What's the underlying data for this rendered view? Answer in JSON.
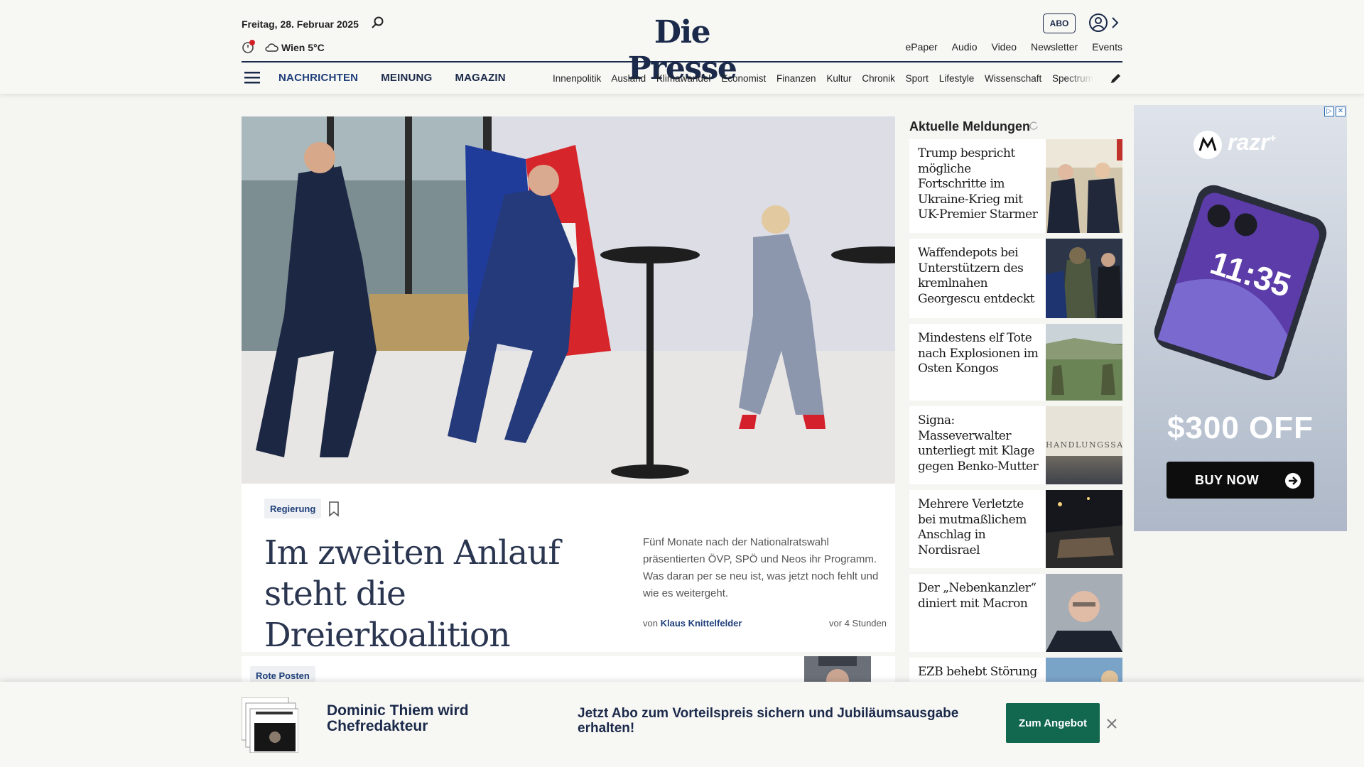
{
  "header": {
    "date": "Freitag, 28. Februar 2025",
    "weather": "Wien 5°C",
    "logo": "Die Presse",
    "abo_label": "ABO",
    "top_links": [
      "ePaper",
      "Audio",
      "Video",
      "Newsletter",
      "Events"
    ],
    "main_nav": [
      "NACHRICHTEN",
      "MEINUNG",
      "MAGAZIN"
    ],
    "sub_nav": [
      "Innenpolitik",
      "Ausland",
      "Klimawandel",
      "Economist",
      "Finanzen",
      "Kultur",
      "Chronik",
      "Sport",
      "Lifestyle",
      "Wissenschaft",
      "Spectrum"
    ]
  },
  "hero": {
    "tag": "Regierung",
    "headline": "Im zweiten Anlauf steht die Dreierkoalition",
    "teaser": "Fünf Monate nach der Nationalratswahl präsentierten ÖVP, SPÖ und Neos ihr Programm. Was daran per se neu ist, was jetzt noch fehlt und wie es weitergeht.",
    "byline_prefix": "von",
    "author": "Klaus Knittelfelder",
    "time": "vor 4 Stunden"
  },
  "second_article": {
    "tag": "Rote Posten"
  },
  "news": {
    "title": "Aktuelle Meldungen",
    "items": [
      "Trump bespricht mögliche Fortschritte im Ukraine-Krieg mit UK-Premier Starmer",
      "Waffendepots bei Unterstützern des kremlnahen Georgescu entdeckt",
      "Mindestens elf Tote nach Explosionen im Osten Kongos",
      "Signa: Masseverwalter unterliegt mit Klage gegen Benko-Mutter",
      "Mehrere Verletzte bei mutmaßlichem Anschlag in Nordisrael",
      "Der „Nebenkanzler“ diniert mit Macron",
      "EZB behebt Störung"
    ],
    "thumb_text_signa": "HANDLUNGSSA"
  },
  "ad": {
    "brand": "razr",
    "brand_sup": "+",
    "phone_time": "11:35",
    "offer": "$300 OFF",
    "button": "BUY NOW"
  },
  "banner": {
    "headline": "Dominic Thiem wird Chefredakteur",
    "cta": "Jetzt Abo zum Vorteilspreis sichern und Jubiläumsausgabe erhalten!",
    "button": "Zum Angebot"
  },
  "colors": {
    "navy": "#1b2a4a",
    "link_blue": "#1f3f7a",
    "cta_green": "#11684f"
  }
}
